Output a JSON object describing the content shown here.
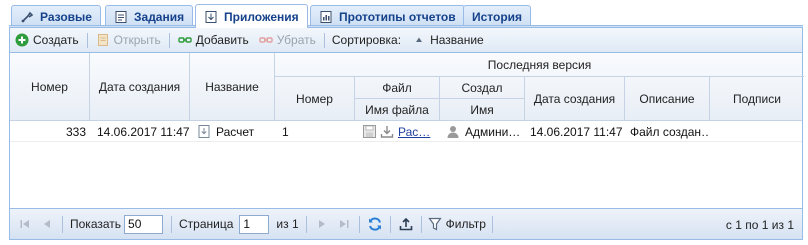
{
  "tabs": [
    {
      "label": "Разовые",
      "icon": "wrench-icon",
      "active": false
    },
    {
      "label": "Задания",
      "icon": "task-list-icon",
      "active": false
    },
    {
      "label": "Приложения",
      "icon": "download-doc-icon",
      "active": true
    },
    {
      "label": "Прототипы отчетов",
      "icon": "report-icon",
      "active": false
    },
    {
      "label": "История",
      "icon": "",
      "active": false
    }
  ],
  "toolbar": {
    "create": "Создать",
    "open": "Открыть",
    "add": "Добавить",
    "remove": "Убрать",
    "sort_label": "Сортировка:",
    "sort_value": "Название"
  },
  "columns": {
    "number": "Номер",
    "created": "Дата создания",
    "name": "Название",
    "latest_version": "Последняя версия",
    "v_number": "Номер",
    "file": "Файл",
    "file_name": "Имя файла",
    "created_by": "Создал",
    "creator_name": "Имя",
    "v_created": "Дата создания",
    "description": "Описание",
    "signatures": "Подписи"
  },
  "rows": [
    {
      "number": "333",
      "created": "14.06.2017 11:47",
      "name": "Расчет",
      "v_number": "1",
      "file_name": "Рас…",
      "creator_name": "Админи…",
      "v_created": "14.06.2017 11:47",
      "description": "Файл создан…",
      "signatures": ""
    }
  ],
  "paging": {
    "show_label": "Показать",
    "page_size": "50",
    "page_label": "Страница",
    "page": "1",
    "of_label": "из 1",
    "filter": "Фильтр",
    "info": "с 1 по 1 из 1"
  },
  "colors": {
    "accent": "#15428b",
    "border": "#99bbe8",
    "create_icon": "#2e9b3d",
    "refresh_icon": "#2a7fd4"
  }
}
